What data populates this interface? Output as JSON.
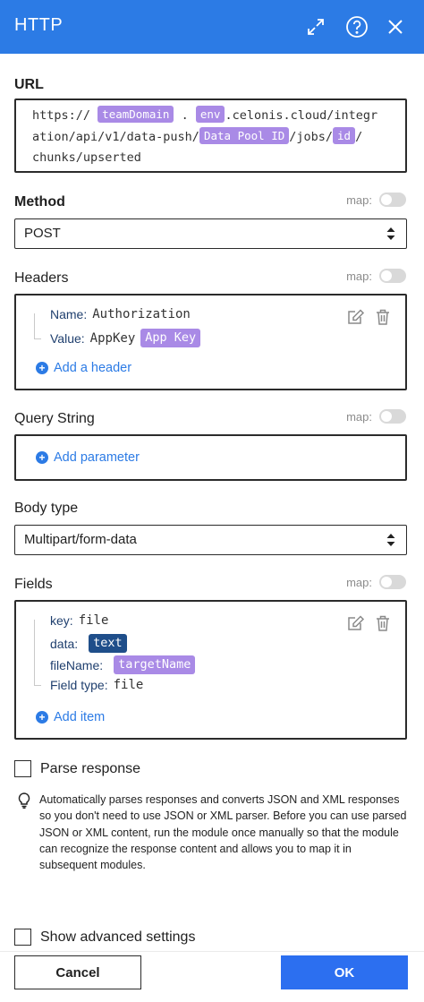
{
  "window": {
    "title": "HTTP",
    "icons": [
      "expand-icon",
      "help-icon",
      "close-icon"
    ]
  },
  "url": {
    "label": "URL",
    "line1": {
      "t1": "https://",
      "p1": "teamDomain",
      "t2": ".",
      "p2": "env",
      "t3": ".celonis.cloud/integr"
    },
    "line2": {
      "t1": "ation/api/v1/data-push/",
      "p1": "Data Pool ID",
      "t2": "/jobs/",
      "p2": "id",
      "t3": "/"
    },
    "line3": {
      "t1": "chunks/upserted"
    }
  },
  "map_label": "map:",
  "method": {
    "label": "Method",
    "value": "POST"
  },
  "headers": {
    "label": "Headers",
    "name_key": "Name:",
    "name_value": "Authorization",
    "value_key": "Value:",
    "value_text": "AppKey",
    "value_pill": "App Key",
    "add_label": "Add a header"
  },
  "query": {
    "label": "Query String",
    "add_label": "Add parameter"
  },
  "body_type": {
    "label": "Body type",
    "value": "Multipart/form-data"
  },
  "fields": {
    "label": "Fields",
    "key_key": "key:",
    "key_value": "file",
    "data_key": "data:",
    "data_pill": "text",
    "filename_key": "fileName:",
    "filename_pill": "targetName",
    "fieldtype_key": "Field type:",
    "fieldtype_value": "file",
    "add_label": "Add item"
  },
  "parse_response": {
    "label": "Parse response",
    "checked": false,
    "info": "Automatically parses responses and converts JSON and XML responses so you don't need to use JSON or XML parser. Before you can use parsed JSON or XML content, run the module once manually so that the module can recognize the response content and allows you to map it in subsequent modules."
  },
  "advanced": {
    "label": "Show advanced settings",
    "checked": false
  },
  "buttons": {
    "cancel": "Cancel",
    "ok": "OK"
  },
  "colors": {
    "accent": "#2c7be5",
    "pill": "#a98ae6",
    "pill_dark": "#1f4e8a",
    "ok_button": "#2c6ff0"
  }
}
